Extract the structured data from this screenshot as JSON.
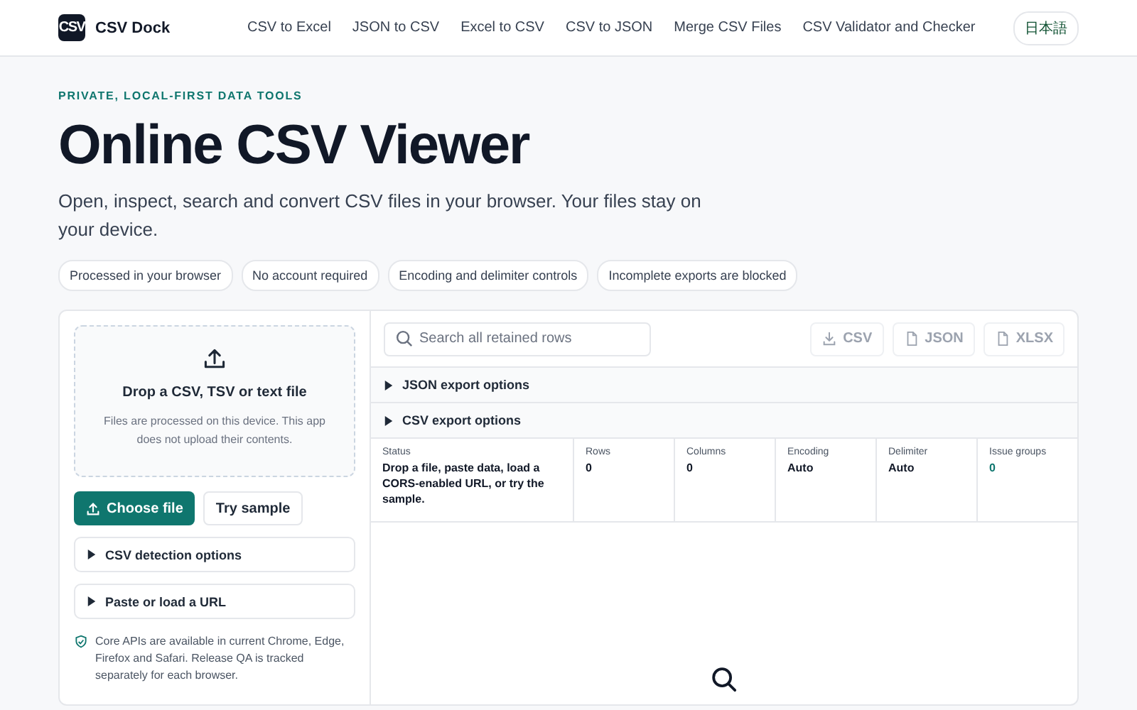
{
  "brand": {
    "logo": "CSV",
    "name": "CSV Dock"
  },
  "nav": [
    "CSV to Excel",
    "JSON to CSV",
    "Excel to CSV",
    "CSV to JSON",
    "Merge CSV Files",
    "CSV Validator and Checker"
  ],
  "language": "日本語",
  "eyebrow": "PRIVATE, LOCAL-FIRST DATA TOOLS",
  "title": "Online CSV Viewer",
  "subtitle": "Open, inspect, search and convert CSV files in your browser. Your files stay on your device.",
  "chips": [
    "Processed in your browser",
    "No account required",
    "Encoding and delimiter controls",
    "Incomplete exports are blocked"
  ],
  "dropzone": {
    "title": "Drop a CSV, TSV or text file",
    "note": "Files are processed on this device. This app does not upload their contents."
  },
  "actions": [
    {
      "label": "Choose file",
      "kind": "primary"
    },
    {
      "label": "Try sample",
      "kind": "secondary"
    }
  ],
  "left_options": [
    {
      "label": "CSV detection options",
      "expanded": false
    },
    {
      "label": "Paste or load a URL",
      "expanded": false
    }
  ],
  "support_note": "Core APIs are available in current Chrome, Edge, Firefox and Safari. Release QA is tracked separately for each browser.",
  "search": {
    "placeholder": "Search all retained rows"
  },
  "exports": [
    {
      "label": "CSV",
      "kind": "download",
      "disabled": true
    },
    {
      "label": "JSON",
      "kind": "file",
      "disabled": true
    },
    {
      "label": "XLSX",
      "kind": "file",
      "disabled": true
    }
  ],
  "export_options": [
    {
      "label": "JSON export options",
      "expanded": false
    },
    {
      "label": "CSV export options",
      "expanded": false
    }
  ],
  "stats": [
    {
      "label": "Status",
      "value": "Drop a file, paste data, load a CORS-enabled URL, or try the sample.",
      "kind": "text"
    },
    {
      "label": "Rows",
      "value": "0",
      "kind": "text"
    },
    {
      "label": "Columns",
      "value": "0",
      "kind": "text"
    },
    {
      "label": "Encoding",
      "value": "Auto",
      "kind": "text"
    },
    {
      "label": "Delimiter",
      "value": "Auto",
      "kind": "text"
    },
    {
      "label": "Issue groups",
      "value": "0",
      "kind": "accent"
    }
  ]
}
